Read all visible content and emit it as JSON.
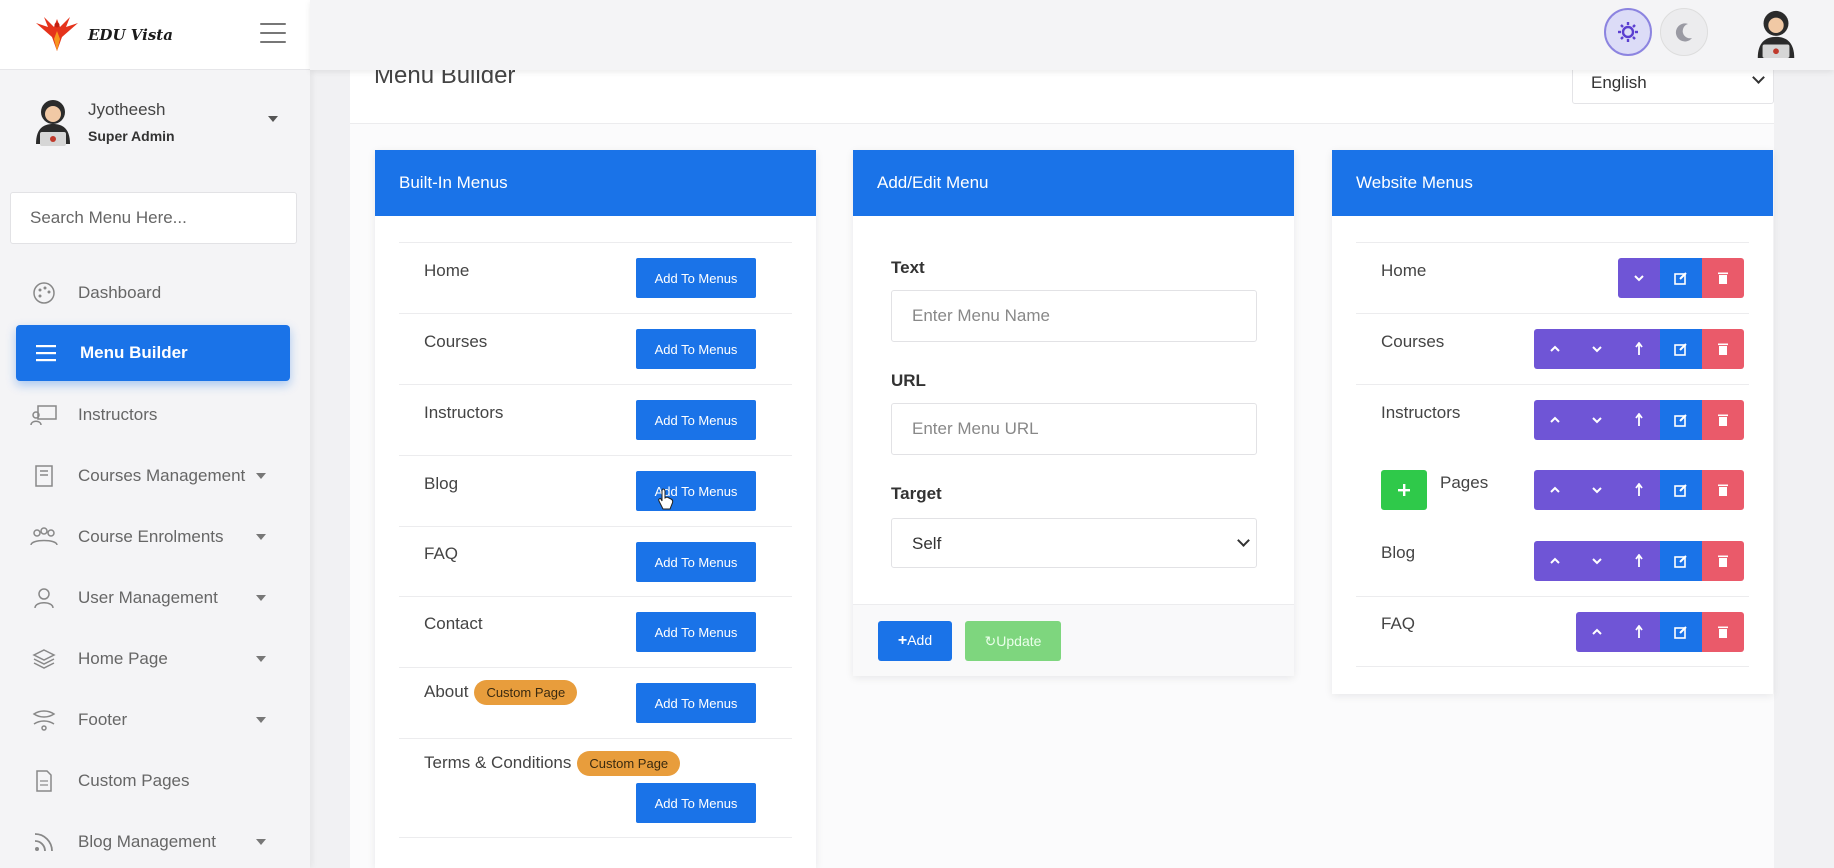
{
  "brand": {
    "name": "EDU Vista"
  },
  "user": {
    "name": "Jyotheesh",
    "role": "Super Admin"
  },
  "sidebar": {
    "search_placeholder": "Search Menu Here...",
    "items": [
      {
        "label": "Dashboard",
        "icon": "palette-icon",
        "caret": false,
        "active": false
      },
      {
        "label": "Menu Builder",
        "icon": "list-icon",
        "caret": false,
        "active": true
      },
      {
        "label": "Instructors",
        "icon": "teacher-icon",
        "caret": false,
        "active": false
      },
      {
        "label": "Courses Management",
        "icon": "book-icon",
        "caret": true,
        "active": false
      },
      {
        "label": "Course Enrolments",
        "icon": "group-icon",
        "caret": true,
        "active": false
      },
      {
        "label": "User Management",
        "icon": "user-icon",
        "caret": true,
        "active": false
      },
      {
        "label": "Home Page",
        "icon": "layers-icon",
        "caret": true,
        "active": false
      },
      {
        "label": "Footer",
        "icon": "footer-icon",
        "caret": true,
        "active": false
      },
      {
        "label": "Custom Pages",
        "icon": "page-icon",
        "caret": false,
        "active": false
      },
      {
        "label": "Blog Management",
        "icon": "rss-icon",
        "caret": true,
        "active": false
      }
    ]
  },
  "header": {
    "page_title": "Menu Builder",
    "language": "English",
    "language_options": [
      "English"
    ]
  },
  "builtin": {
    "title": "Built-In Menus",
    "button_label": "Add To Menus",
    "badge_label": "Custom Page",
    "items": [
      {
        "label": "Home",
        "badge": false
      },
      {
        "label": "Courses",
        "badge": false
      },
      {
        "label": "Instructors",
        "badge": false
      },
      {
        "label": "Blog",
        "badge": false
      },
      {
        "label": "FAQ",
        "badge": false
      },
      {
        "label": "Contact",
        "badge": false
      },
      {
        "label": "About",
        "badge": true
      },
      {
        "label": "Terms & Conditions",
        "badge": true
      }
    ]
  },
  "editor": {
    "title": "Add/Edit Menu",
    "text_label": "Text",
    "text_placeholder": "Enter Menu Name",
    "url_label": "URL",
    "url_placeholder": "Enter Menu URL",
    "target_label": "Target",
    "target_value": "Self",
    "target_options": [
      "Self"
    ],
    "add_label": "Add",
    "update_label": "Update"
  },
  "website": {
    "title": "Website Menus",
    "items": [
      {
        "label": "Home",
        "actions": [
          "down",
          "edit",
          "delete"
        ],
        "child_toggle": false
      },
      {
        "label": "Courses",
        "actions": [
          "up",
          "down",
          "indent",
          "edit",
          "delete"
        ],
        "child_toggle": false
      },
      {
        "label": "Instructors",
        "actions": [
          "up",
          "down",
          "indent",
          "edit",
          "delete"
        ],
        "child_toggle": false
      },
      {
        "label": "Pages",
        "actions": [
          "up",
          "down",
          "indent",
          "edit",
          "delete"
        ],
        "child_toggle": true
      },
      {
        "label": "Blog",
        "actions": [
          "up",
          "down",
          "indent",
          "edit",
          "delete"
        ],
        "child_toggle": false
      },
      {
        "label": "FAQ",
        "actions": [
          "up",
          "indent",
          "edit",
          "delete"
        ],
        "child_toggle": false
      }
    ]
  },
  "colors": {
    "primary": "#1a73e8",
    "purple": "#6f55d6",
    "danger": "#ea5a6a",
    "success": "#2fc94a",
    "badge": "#e89d3c"
  }
}
